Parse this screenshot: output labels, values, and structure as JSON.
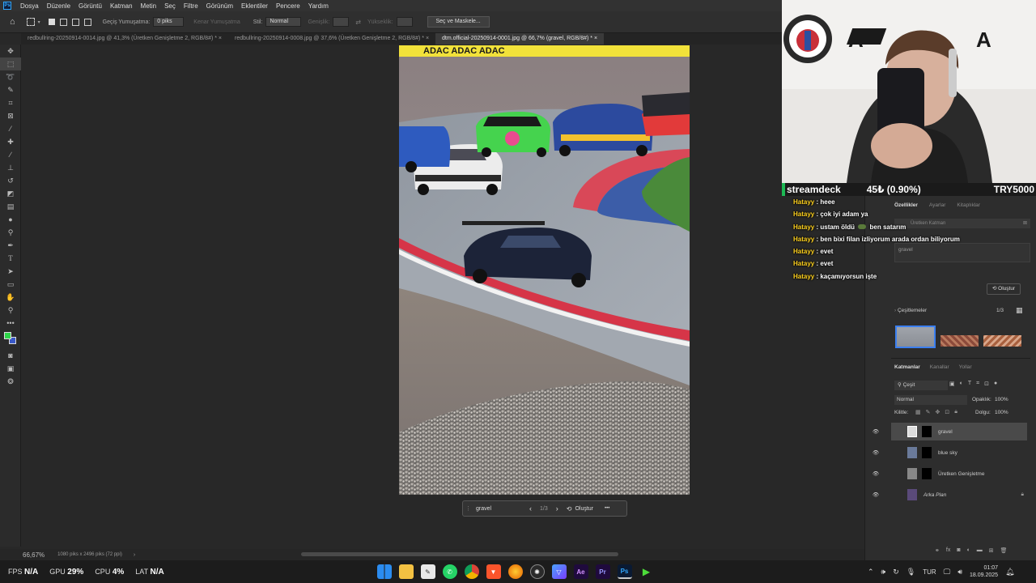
{
  "menubar": {
    "items": [
      "Dosya",
      "Düzenle",
      "Görüntü",
      "Katman",
      "Metin",
      "Seç",
      "Filtre",
      "Görünüm",
      "Eklentiler",
      "Pencere",
      "Yardım"
    ]
  },
  "options": {
    "feather_label": "Geçiş Yumuşatma:",
    "feather_value": "0 piks",
    "antialias_label": "Kenar Yumuşatma",
    "style_label": "Stil:",
    "style_value": "Normal",
    "width_label": "Genişlik:",
    "height_label": "Yükseklik:",
    "mask_button": "Seç ve Maskele..."
  },
  "tabs": [
    {
      "label": "redbullring-20250914-0014.jpg @ 41,3% (Üretken Genişletme 2, RGB/8#) *"
    },
    {
      "label": "redbullring-20250914-0008.jpg @ 37,6% (Üretken Genişletme 2, RGB/8#) *"
    },
    {
      "label": "dtm.official-20250914-0001.jpg @ 66,7% (gravel, RGB/8#) *"
    }
  ],
  "photo": {
    "banner_text": "ADAC   ADAC   ADAC"
  },
  "context_bar": {
    "prompt": "gravel",
    "counter": "1/3",
    "generate": "Oluştur",
    "more": "•••"
  },
  "status": {
    "zoom": "66,67%",
    "doc_info": "1080 piks x 2496 piks (72 ppi)"
  },
  "stream": {
    "stock_name": "streamdeck",
    "stock_change": "45₺ (0.90%)",
    "stock_value": "TRY5000"
  },
  "chat": [
    {
      "user": "Hatayy",
      "msg": "heee"
    },
    {
      "user": "Hatayy",
      "msg": "çok iyi adam ya"
    },
    {
      "user": "Hatayy",
      "msg": "ustam öldü"
    },
    {
      "user": "",
      "msg": "ben satarım"
    },
    {
      "user": "Hatayy",
      "msg": "ben bixi filan izliyorum arada ordan biliyorum"
    },
    {
      "user": "Hatayy",
      "msg": "evet"
    },
    {
      "user": "Hatayy",
      "msg": "evet"
    },
    {
      "user": "Hatayy",
      "msg": "kaçamıyorsun işte"
    }
  ],
  "props_panel": {
    "tabs": [
      "Özellikler",
      "Ayarlar",
      "Kitaplıklar"
    ],
    "layer_type": "Üretken Katman",
    "prompt": "gravel",
    "generate": "Oluştur",
    "variations_label": "Çeşitlemeler",
    "variations_count": "1/3"
  },
  "layers_panel": {
    "tabs": [
      "Katmanlar",
      "Kanallar",
      "Yollar"
    ],
    "filter_label": "Çeşit",
    "blend_mode": "Normal",
    "opacity_label": "Opaklık:",
    "opacity_value": "100%",
    "lock_label": "Kilitle:",
    "fill_label": "Dolgu:",
    "fill_value": "100%",
    "layers": [
      {
        "name": "gravel"
      },
      {
        "name": "blue sky"
      },
      {
        "name": "Üretken Genişletme"
      },
      {
        "name": "Arka Plan"
      }
    ]
  },
  "taskbar": {
    "fps_label": "FPS",
    "fps_value": "N/A",
    "gpu_label": "GPU",
    "gpu_value": "29%",
    "cpu_label": "CPU",
    "cpu_value": "4%",
    "lat_label": "LAT",
    "lat_value": "N/A",
    "lang": "TUR",
    "time": "01:07",
    "date": "18.09.2025",
    "apps": [
      "windows-icon",
      "folder-icon",
      "notepad-icon",
      "whatsapp-icon",
      "chrome-icon",
      "brave-icon",
      "firefox-icon",
      "chatgpt-icon",
      "vpn-icon",
      "after-effects-icon",
      "premiere-icon",
      "photoshop-icon",
      "media-icon"
    ]
  },
  "colors": {
    "accent": "#31a8ff",
    "chat_user": "#ffd21f",
    "stock_up": "#1db954"
  }
}
